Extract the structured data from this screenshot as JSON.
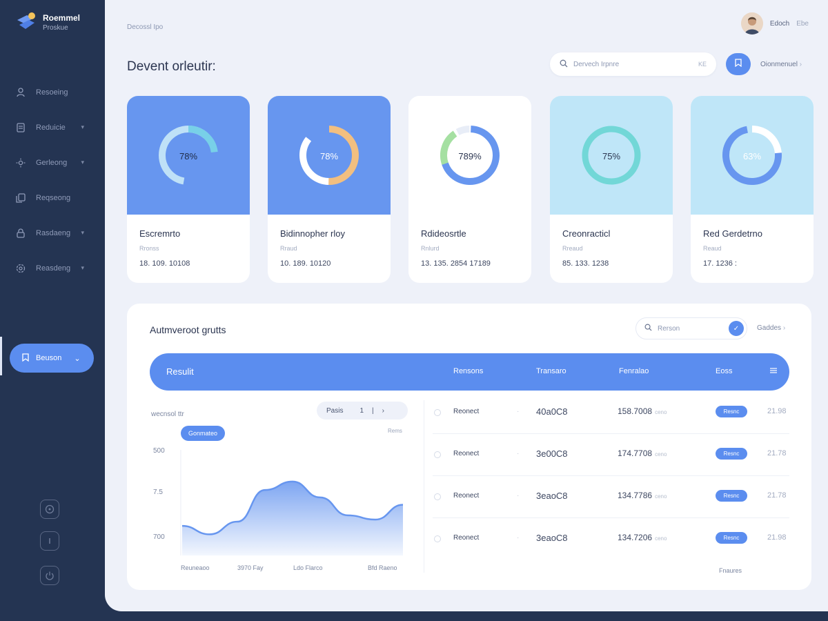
{
  "app": {
    "name": "Roemmel",
    "subtitle": "Proskue"
  },
  "sidebar": {
    "items": [
      {
        "label": "Resoeing",
        "icon": "user-icon",
        "has_chevron": false
      },
      {
        "label": "Reduicie",
        "icon": "file-icon",
        "has_chevron": true
      },
      {
        "label": "Gerleong",
        "icon": "sun-icon",
        "has_chevron": true
      },
      {
        "label": "Reqseong",
        "icon": "copy-icon",
        "has_chevron": false
      },
      {
        "label": "Rasdaeng",
        "icon": "lock-icon",
        "has_chevron": true
      },
      {
        "label": "Reasdeng",
        "icon": "settings-icon",
        "has_chevron": true
      }
    ],
    "active_button": {
      "label": "Beuson",
      "icon": "bookmark-icon",
      "chevron": "⌄"
    },
    "bottom_icons": [
      "help-icon",
      "info-icon",
      "power-icon"
    ]
  },
  "header": {
    "breadcrumb": "Decossl Ipo",
    "title": "Devent orleutir:",
    "user_name": "Edoch",
    "user_menu": "Ebe",
    "search_placeholder": "Dervech Irpnre",
    "search_kbd": "KE",
    "action_label": "Oionmenuel"
  },
  "cards": [
    {
      "title": "Escremrto",
      "sub": "Rronss",
      "value": "18. 109. 10108",
      "pct": "78%",
      "fill": 0.78,
      "top_bg": "#6796ef",
      "inner_bg": "#6796ef",
      "arc": "#78d0e8",
      "track": "#bfe1f7",
      "pct_color": "#1e2b47"
    },
    {
      "title": "Bidinnopher rloy",
      "sub": "Rraud",
      "value": "10. 189. 10120",
      "pct": "78%",
      "fill": 0.78,
      "top_bg": "#6796ef",
      "inner_bg": "#6796ef",
      "arc": "#f2bf80",
      "track": "#ffffff",
      "pct_color": "#ffffff"
    },
    {
      "title": "Rdideosrtle",
      "sub": "Rnlurd",
      "value": "13. 135. 2854 17189",
      "pct": "789%",
      "fill": 0.78,
      "top_bg": "#ffffff",
      "inner_bg": "#ffffff",
      "arc": "#6796ef",
      "track": "#a5e0a2",
      "pct_color": "#2b3550"
    },
    {
      "title": "Creonracticl",
      "sub": "Rreaud",
      "value": "85. 133. 1238",
      "pct": "75%",
      "fill": 1.0,
      "top_bg": "#bfe6f8",
      "inner_bg": "#bfe6f8",
      "arc": "#72d7d7",
      "track": "#72d7d7",
      "pct_color": "#2b3550"
    },
    {
      "title": "Red Gerdetrno",
      "sub": "Reaud",
      "value": "17. 1236 :",
      "pct": "63%",
      "fill": 0.63,
      "top_bg": "#bfe6f8",
      "inner_bg": "#bfe6f8",
      "arc": "#6796ef",
      "track": "#ffffff",
      "pct_color": "#ffffff"
    }
  ],
  "panel": {
    "title": "Autmveroot grutts",
    "search_placeholder": "Rerson",
    "link": "Gaddes",
    "columns": [
      "Resulit",
      "Rensons",
      "Transaro",
      "Fenralao",
      "Eoss"
    ],
    "chart": {
      "label": "wecnsol ttr",
      "pager": {
        "label": "Pasis",
        "mid": "1",
        "sep": "|",
        "arrow": "›"
      },
      "chip": "Gonmateo",
      "small_label": "Rems"
    },
    "rows": [
      {
        "name": "Reonect",
        "amount": "40a0C8",
        "value": "158.7008",
        "value_small": "ceno",
        "badge": "Resnc",
        "time": "21.98"
      },
      {
        "name": "Reonect",
        "amount": "3e00C8",
        "value": "174.7708",
        "value_small": "ceno",
        "badge": "Resnc",
        "time": "21.78"
      },
      {
        "name": "Reonect",
        "amount": "3eaoC8",
        "value": "134.7786",
        "value_small": "ceno",
        "badge": "Resnc",
        "time": "21.78"
      },
      {
        "name": "Reonect",
        "amount": "3eaoC8",
        "value": "134.7206",
        "value_small": "ceno",
        "badge": "Resnc",
        "time": "21.98"
      }
    ],
    "footer": "Fnaures"
  },
  "chart_data": {
    "type": "area",
    "x": [
      "Reuneaoo",
      "3970 Fay",
      "Ldo Flarco",
      "Bfd Raeno"
    ],
    "yticks": [
      "500",
      "7.5",
      "700"
    ],
    "series": [
      {
        "values": [
          0.28,
          0.2,
          0.32,
          0.62,
          0.7,
          0.55,
          0.38,
          0.34,
          0.48
        ]
      }
    ],
    "fill_color": "#6796ef",
    "grid": false
  }
}
